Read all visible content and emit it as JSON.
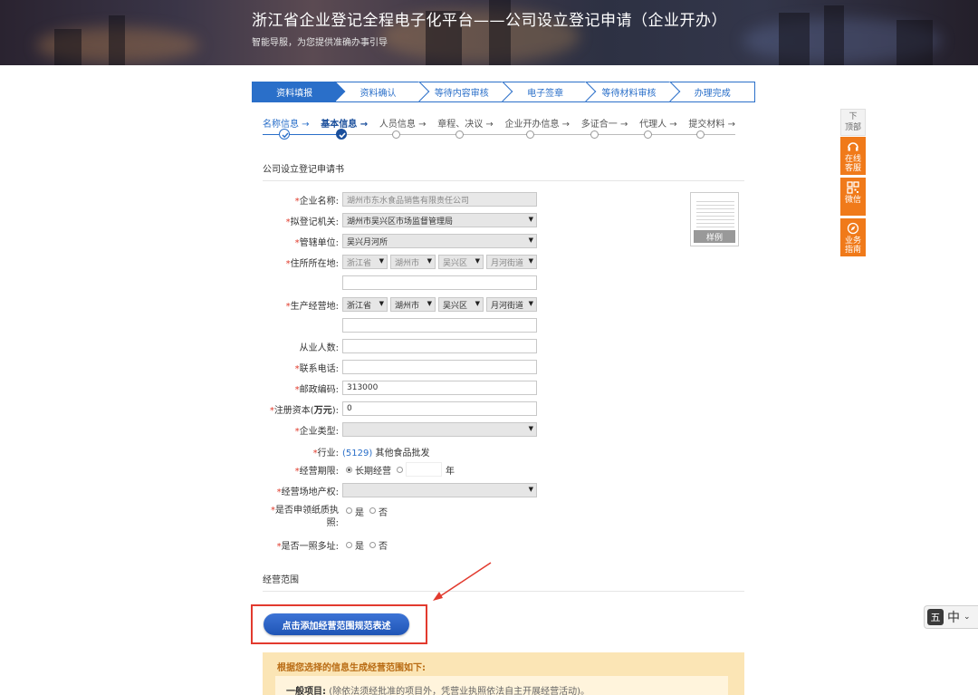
{
  "banner": {
    "title": "浙江省企业登记全程电子化平台——公司设立登记申请（企业开办）",
    "subtitle": "智能导服，为您提供准确办事引导"
  },
  "steps": [
    "资料填报",
    "资料确认",
    "等待内容审核",
    "电子签章",
    "等待材料审核",
    "办理完成"
  ],
  "subprogress": [
    "名称信息 →",
    "基本信息 →",
    "人员信息 →",
    "章程、决议 →",
    "企业开办信息 →",
    "多证合一 →",
    "代理人 →",
    "提交材料 →"
  ],
  "form": {
    "section_title": "公司设立登记申请书",
    "company_name_label": "企业名称:",
    "company_name_value": "湖州市东水食品销售有限责任公司",
    "registration_authority_label": "拟登记机关:",
    "registration_authority_value": "湖州市吴兴区市场监督管理局",
    "jurisdiction_label": "管辖单位:",
    "jurisdiction_value": "吴兴月河所",
    "domicile_label": "住所所在地:",
    "domicile_values": [
      "浙江省",
      "湖州市",
      "吴兴区",
      "月河街道"
    ],
    "production_label": "生产经营地:",
    "production_values": [
      "浙江省",
      "湖州市",
      "吴兴区",
      "月河街道"
    ],
    "employees_label": "从业人数:",
    "phone_label": "联系电话:",
    "postcode_label": "邮政编码:",
    "postcode_value": "313000",
    "capital_label_pre": "注册资本(",
    "capital_label_bold": "万元",
    "capital_label_post": "):",
    "capital_value": "0",
    "company_type_label": "企业类型:",
    "industry_label": "行业:",
    "industry_code": "(5129)",
    "industry_value": "其他食品批发",
    "term_label": "经营期限:",
    "term_long": "长期经营",
    "term_year": "年",
    "property_label": "经营场地产权:",
    "paper_license_label_1": "是否申领纸质执",
    "paper_license_label_2": "照:",
    "yes": "是",
    "no": "否",
    "multi_address_label": "是否一照多址:"
  },
  "sample": {
    "tag": "样例"
  },
  "scope": {
    "section_title": "经营范围",
    "button_label": "点击添加经营范围规范表述",
    "result_head": "根据您选择的信息生成经营范围如下:",
    "general_items": "一般项目:",
    "general_note": "(除依法须经批准的项目外，凭营业执照依法自主开展经营活动)。"
  },
  "float": {
    "top_line1": "下",
    "top_line2": "顶部",
    "service_1": "在线",
    "service_2": "客服",
    "wechat": "微信",
    "guide_1": "业务",
    "guide_2": "指南"
  },
  "ime": {
    "badge": "五",
    "mode": "中"
  },
  "colors": {
    "brand_blue": "#2a6fc9",
    "accent_orange": "#f07a1a",
    "required_red": "#e03a2b",
    "highlight_red": "#e23a2e"
  }
}
